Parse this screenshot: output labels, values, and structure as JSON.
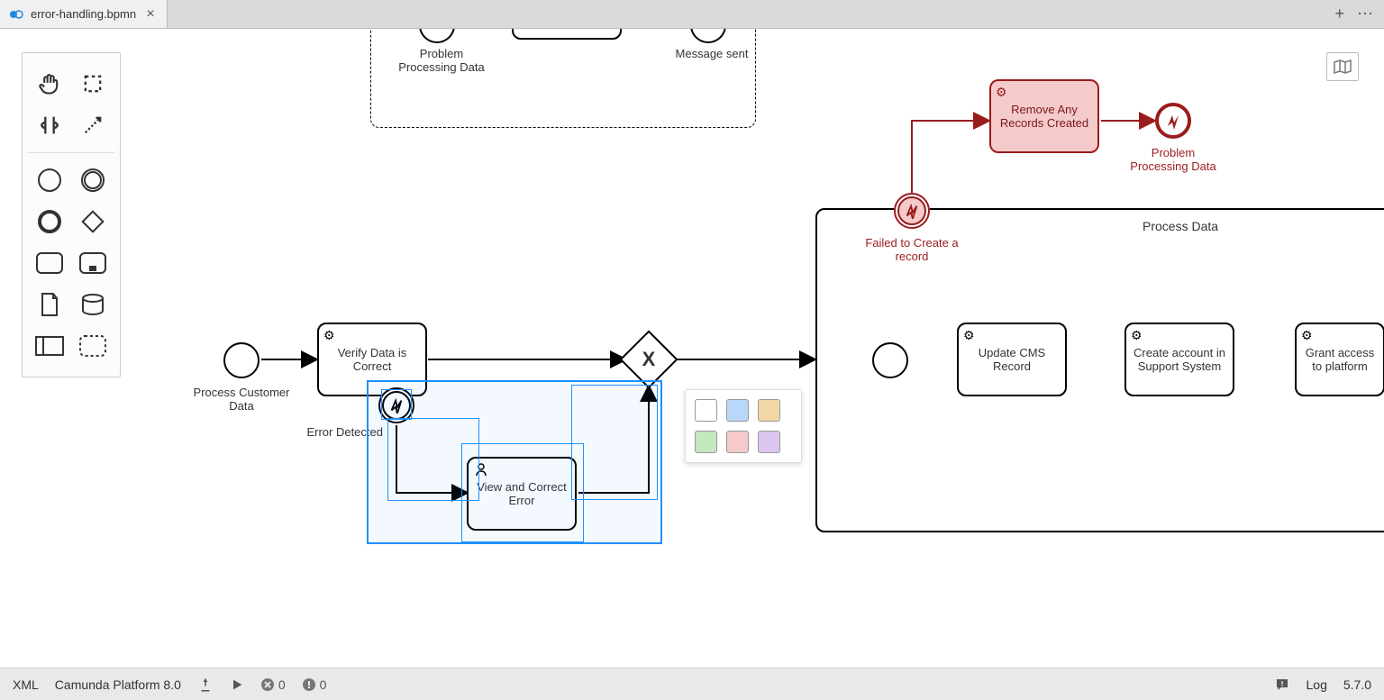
{
  "tab": {
    "filename": "error-handling.bpmn"
  },
  "canvas": {
    "top_group": {
      "label1": "Problem Processing Data",
      "label2": "Message sent"
    },
    "start": {
      "label": "Process Customer Data"
    },
    "verify_task": "Verify Data is Correct",
    "error_boundary_label": "Error Detected",
    "view_correct_task": "View and Correct Error",
    "remove_records_task": "Remove Any Records Created",
    "problem_end_label": "Problem Processing Data",
    "failed_boundary_label": "Failed to Create a record",
    "subprocess": {
      "label": "Process Data",
      "update_cms": "Update CMS Record",
      "create_account": "Create account in Support System",
      "grant_access": "Grant access to platform"
    },
    "color_palette": [
      "#ffffff",
      "#b8d8f7",
      "#f3d8a5",
      "#c5e7c0",
      "#f4caca",
      "#dcc5f0"
    ]
  },
  "statusbar": {
    "xml": "XML",
    "platform": "Camunda Platform 8.0",
    "errors": 0,
    "warnings": 0,
    "log": "Log",
    "version": "5.7.0"
  }
}
